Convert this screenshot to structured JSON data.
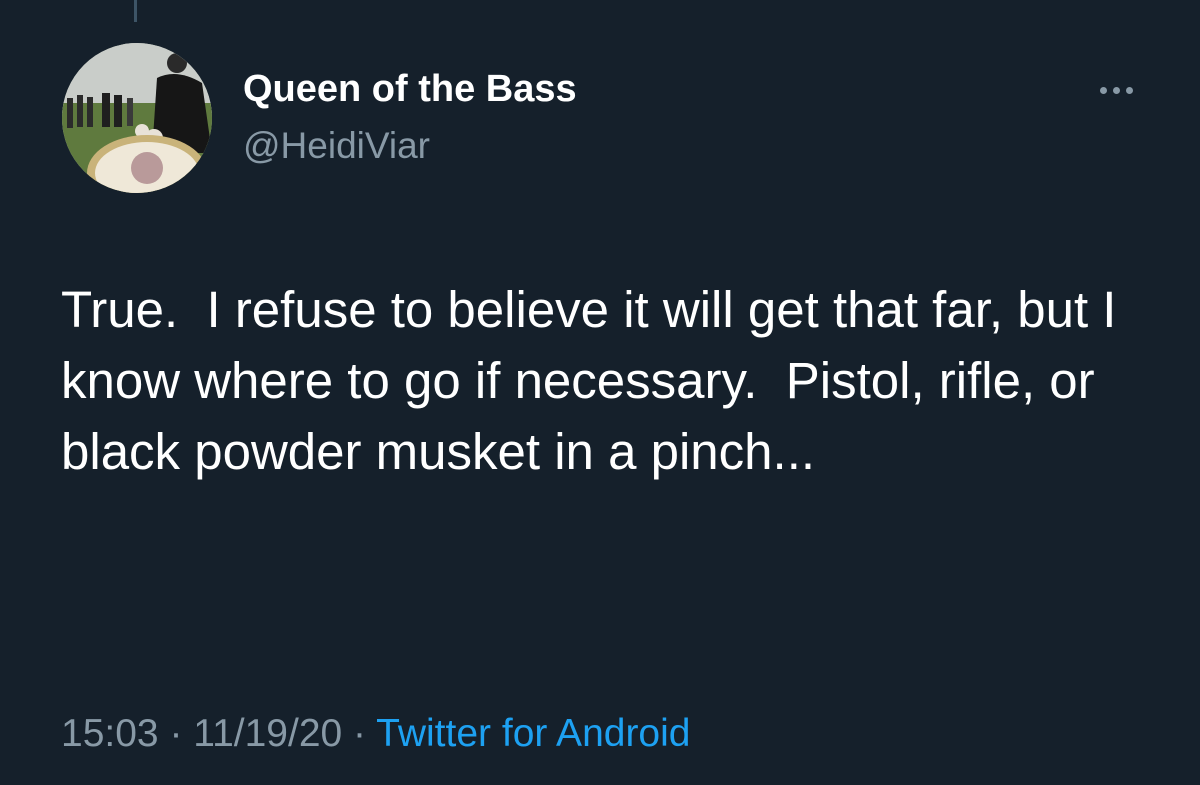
{
  "tweet": {
    "author": {
      "display_name": "Queen of the Bass",
      "handle": "@HeidiViar"
    },
    "more_icon": "more-dots-icon",
    "text": "True.  I refuse to believe it will get that far, but I know where to go if necessary.  Pistol, rifle, or black powder musket in a pinch...",
    "time": "15:03",
    "date": "11/19/20",
    "separator": " · ",
    "source": "Twitter for Android",
    "colors": {
      "background": "#15202b",
      "text": "#ffffff",
      "secondary": "#8899a6",
      "link": "#1da1f2"
    }
  }
}
